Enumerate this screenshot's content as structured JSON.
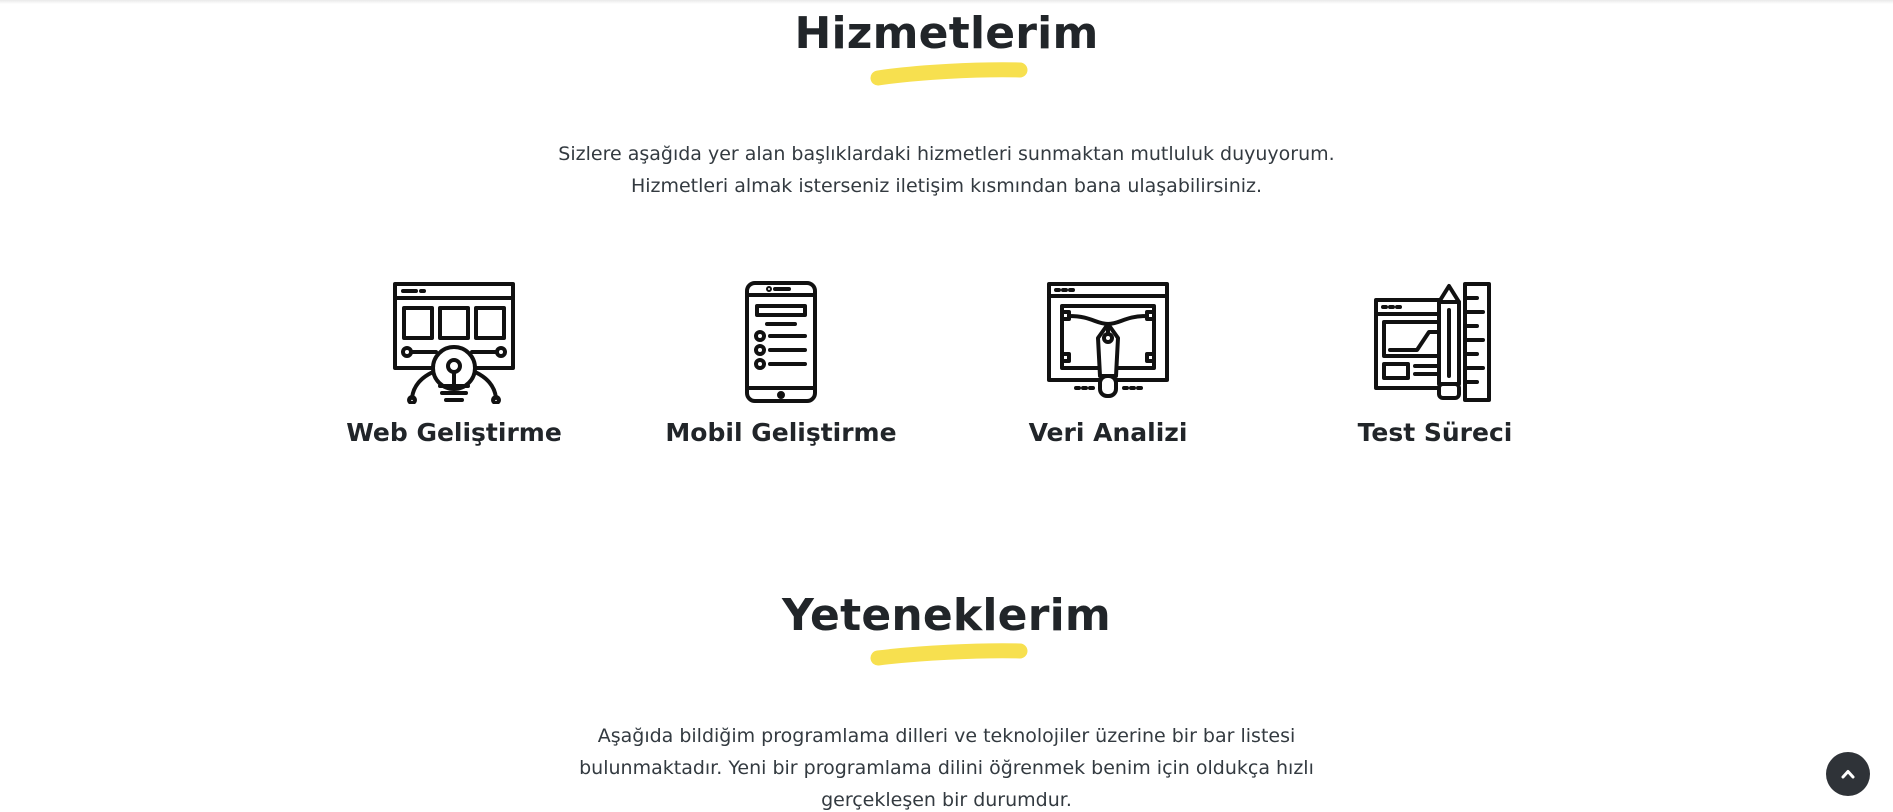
{
  "services_section": {
    "title": "Hizmetlerim",
    "description_lines": [
      "Sizlere aşağıda yer alan başlıklardaki hizmetleri sunmaktan mutluluk duyuyorum.",
      "Hizmetleri almak isterseniz iletişim kısmından bana ulaşabilirsiniz."
    ],
    "items": [
      {
        "label": "Web Geliştirme",
        "icon": "web-development-icon"
      },
      {
        "label": "Mobil Geliştirme",
        "icon": "mobile-phone-icon"
      },
      {
        "label": "Veri Analizi",
        "icon": "pen-tool-design-icon"
      },
      {
        "label": "Test Süreci",
        "icon": "browser-ruler-pencil-icon"
      }
    ]
  },
  "skills_section": {
    "title": "Yeteneklerim",
    "description_lines": [
      "Aşağıda bildiğim programlama dilleri ve teknolojiler üzerine bir bar listesi",
      "bulunmaktadır. Yeni bir programlama dilini öğrenmek benim için oldukça hızlı",
      "gerçekleşen bir durumdur."
    ]
  },
  "scroll_top_button": {
    "icon": "chevron-up-icon"
  },
  "colors": {
    "accent_underline": "#f7e04f",
    "text": "#212529",
    "scroll_button_bg": "#2f3338"
  }
}
